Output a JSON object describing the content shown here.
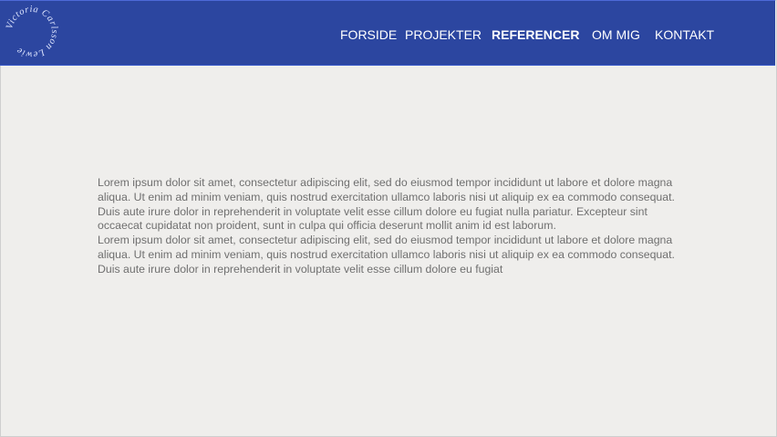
{
  "logo": {
    "text": "Victoria Carlsson Lewie",
    "color": "#dfe6ff"
  },
  "nav": {
    "items": [
      {
        "label": "FORSIDE",
        "active": false
      },
      {
        "label": "PROJEKTER",
        "active": false
      },
      {
        "label": "REFERENCER",
        "active": true
      },
      {
        "label": "OM MIG",
        "active": false
      },
      {
        "label": "KONTAKT",
        "active": false
      }
    ]
  },
  "content": {
    "paragraph_1": "Lorem ipsum dolor sit amet, consectetur adipiscing elit, sed do eiusmod tempor incididunt ut labore et dolore magna aliqua. Ut enim ad minim veniam, quis nostrud exercitation ullamco laboris nisi ut aliquip ex ea commodo consequat. Duis aute irure dolor in reprehenderit in voluptate velit esse cillum dolore eu fugiat nulla pariatur. Excepteur sint occaecat cupidatat non proident, sunt in culpa qui officia deserunt mollit anim id est laborum.",
    "paragraph_2": "Lorem ipsum dolor sit amet, consectetur adipiscing elit, sed do eiusmod tempor incididunt ut labore et dolore magna aliqua. Ut enim ad minim veniam, quis nostrud exercitation ullamco laboris nisi ut aliquip ex ea commodo consequat. Duis aute irure dolor in reprehenderit in voluptate velit esse cillum dolore eu fugiat"
  },
  "colors": {
    "header_bg": "#2c46a0",
    "page_bg": "#efeeec",
    "body_text": "#6f6f6f",
    "nav_text": "#ffffff"
  }
}
